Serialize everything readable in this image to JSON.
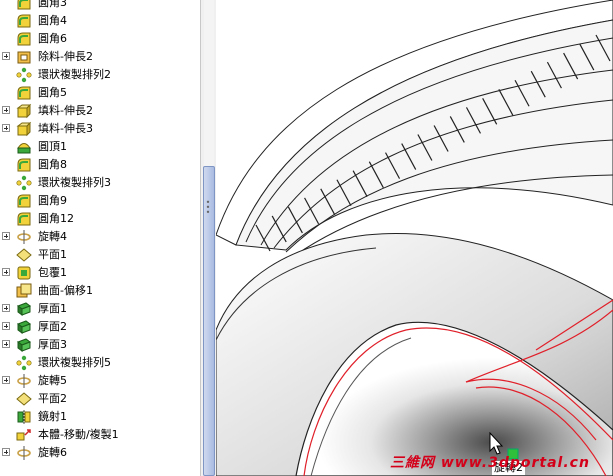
{
  "feature_tree": {
    "items": [
      {
        "label": "圓角3",
        "icon": "fillet-icon",
        "expandable": false
      },
      {
        "label": "圓角4",
        "icon": "fillet-icon",
        "expandable": false
      },
      {
        "label": "圓角6",
        "icon": "fillet-icon",
        "expandable": false
      },
      {
        "label": "除料-伸長2",
        "icon": "extruded-cut-icon",
        "expandable": true
      },
      {
        "label": "環狀複製排列2",
        "icon": "circular-pattern-icon",
        "expandable": false
      },
      {
        "label": "圓角5",
        "icon": "fillet-icon",
        "expandable": false
      },
      {
        "label": "填料-伸長2",
        "icon": "extruded-boss-icon",
        "expandable": true
      },
      {
        "label": "填料-伸長3",
        "icon": "extruded-boss-icon",
        "expandable": true
      },
      {
        "label": "圓頂1",
        "icon": "dome-icon",
        "expandable": false
      },
      {
        "label": "圓角8",
        "icon": "fillet-icon",
        "expandable": false
      },
      {
        "label": "環狀複製排列3",
        "icon": "circular-pattern-icon",
        "expandable": false
      },
      {
        "label": "圓角9",
        "icon": "fillet-icon",
        "expandable": false
      },
      {
        "label": "圓角12",
        "icon": "fillet-icon",
        "expandable": false
      },
      {
        "label": "旋轉4",
        "icon": "revolve-icon",
        "expandable": true
      },
      {
        "label": "平面1",
        "icon": "plane-icon",
        "expandable": false
      },
      {
        "label": "包覆1",
        "icon": "wrap-icon",
        "expandable": true
      },
      {
        "label": "曲面-偏移1",
        "icon": "offset-surface-icon",
        "expandable": false
      },
      {
        "label": "厚面1",
        "icon": "thicken-icon",
        "expandable": true
      },
      {
        "label": "厚面2",
        "icon": "thicken-icon",
        "expandable": true
      },
      {
        "label": "厚面3",
        "icon": "thicken-icon",
        "expandable": true
      },
      {
        "label": "環狀複製排列5",
        "icon": "circular-pattern-icon",
        "expandable": false
      },
      {
        "label": "旋轉5",
        "icon": "revolve-icon",
        "expandable": true
      },
      {
        "label": "平面2",
        "icon": "plane-icon",
        "expandable": false
      },
      {
        "label": "鏡射1",
        "icon": "mirror-icon",
        "expandable": false
      },
      {
        "label": "本體-移動/複製1",
        "icon": "move-copy-body-icon",
        "expandable": false
      },
      {
        "label": "旋轉6",
        "icon": "revolve-icon",
        "expandable": true
      }
    ]
  },
  "viewport": {
    "hover_tooltip": "旋轉2"
  },
  "watermark": "三維网 www.3dportal.cn",
  "colors": {
    "fillet_yellow": "#f2d23a",
    "feature_green": "#3aa83a",
    "plane_yellow": "#f3e07a",
    "revolve_tan": "#c9a24a",
    "sketch_red": "#e0202a",
    "scroll_blue": "#a9bbe2"
  }
}
